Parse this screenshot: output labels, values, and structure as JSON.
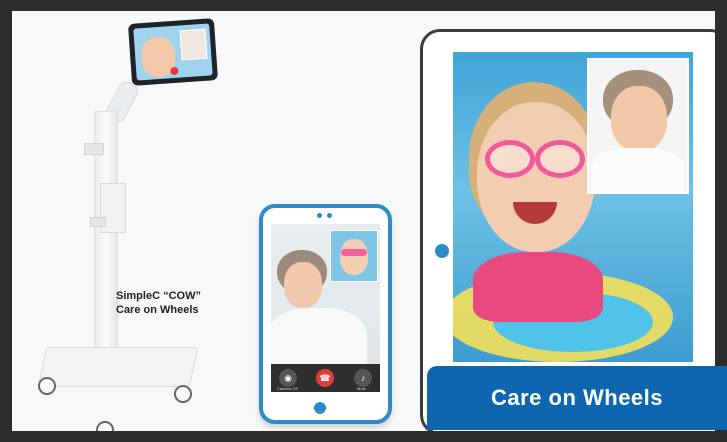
{
  "caption": {
    "line1": "SimpleC “COW”",
    "line2": "Care on Wheels"
  },
  "banner": {
    "text": "Care on Wheels"
  },
  "phone": {
    "buttons": [
      {
        "name": "camera-off",
        "label": "Camera Off",
        "icon": "camera-icon"
      },
      {
        "name": "end-call",
        "label": "",
        "icon": "phone-hangup-icon"
      },
      {
        "name": "mute",
        "label": "Mute",
        "icon": "microphone-icon"
      }
    ]
  },
  "colors": {
    "accent": "#2e8bc5",
    "banner": "#0f66b0",
    "end_call": "#e43c3c",
    "frame": "#2d2d2d"
  }
}
